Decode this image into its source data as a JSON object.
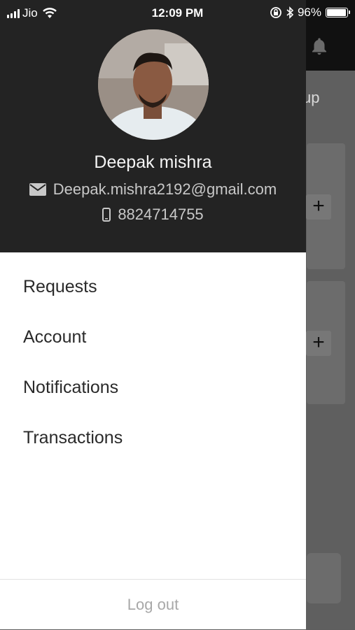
{
  "status_bar": {
    "carrier": "Jio",
    "time": "12:09 PM",
    "battery": "96%",
    "battery_level": 0.96,
    "icons": [
      "signal-bars-icon",
      "wifi-icon",
      "orientation-lock-icon",
      "bluetooth-icon",
      "battery-icon"
    ]
  },
  "background": {
    "partial_text": "up",
    "bell_icon": "bell-icon",
    "plus_label": "+"
  },
  "drawer": {
    "profile": {
      "name": "Deepak mishra",
      "email": "Deepak.mishra2192@gmail.com",
      "phone": "8824714755",
      "email_icon": "mail-icon",
      "phone_icon": "mobile-phone-icon"
    },
    "menu": [
      {
        "label": "Requests"
      },
      {
        "label": "Account"
      },
      {
        "label": "Notifications"
      },
      {
        "label": "Transactions"
      }
    ],
    "logout_label": "Log out"
  },
  "colors": {
    "drawer_header": "#232323",
    "overlay": "#5f5f5f",
    "menu_text": "#2a2a2a",
    "logout_text": "#a8a8a8"
  }
}
